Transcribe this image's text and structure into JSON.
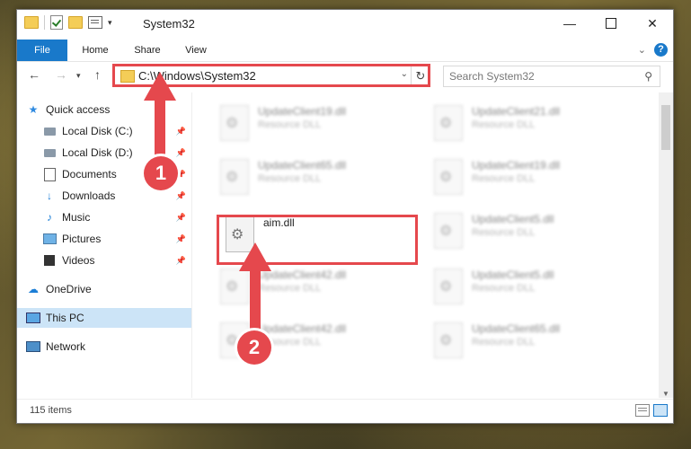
{
  "window": {
    "title": "System32"
  },
  "ribbon": {
    "tabs": [
      "File",
      "Home",
      "Share",
      "View"
    ],
    "help": "?"
  },
  "nav": {
    "back": "←",
    "forward": "→",
    "recent": "▾",
    "up": "↑"
  },
  "address": {
    "path": "C:\\Windows\\System32",
    "refresh": "↻",
    "dropdown": "⌄"
  },
  "search": {
    "placeholder": "Search System32",
    "icon": "⚲"
  },
  "sidebar": [
    {
      "label": "Quick access",
      "icon": "star-icon",
      "pinned": false
    },
    {
      "label": "Local Disk (C:)",
      "icon": "disk-icon",
      "pinned": true
    },
    {
      "label": "Local Disk (D:)",
      "icon": "disk-icon",
      "pinned": true
    },
    {
      "label": "Documents",
      "icon": "document-icon",
      "pinned": true
    },
    {
      "label": "Downloads",
      "icon": "download-icon",
      "pinned": true
    },
    {
      "label": "Music",
      "icon": "music-icon",
      "pinned": true
    },
    {
      "label": "Pictures",
      "icon": "pictures-icon",
      "pinned": true
    },
    {
      "label": "Videos",
      "icon": "videos-icon",
      "pinned": true
    },
    {
      "label": "OneDrive",
      "icon": "cloud-icon",
      "pinned": false
    },
    {
      "label": "This PC",
      "icon": "pc-icon",
      "pinned": false,
      "selected": true
    },
    {
      "label": "Network",
      "icon": "network-icon",
      "pinned": false
    }
  ],
  "files": [
    {
      "name": "UpdateClient19.dll",
      "type": "Resource DLL"
    },
    {
      "name": "UpdateClient21.dll",
      "type": "Resource DLL"
    },
    {
      "name": "UpdateClient65.dll",
      "type": "Resource DLL"
    },
    {
      "name": "UpdateClient19.dll",
      "type": "Resource DLL"
    },
    {
      "name": "aim.dll",
      "type": ""
    },
    {
      "name": "UpdateClient5.dll",
      "type": "Resource DLL"
    },
    {
      "name": "UpdateClient42.dll",
      "type": "Resource DLL"
    },
    {
      "name": "UpdateClient5.dll",
      "type": "Resource DLL"
    },
    {
      "name": "UpdateClient42.dll",
      "type": "Resource DLL"
    },
    {
      "name": "UpdateClient65.dll",
      "type": "Resource DLL"
    }
  ],
  "status": {
    "count": "115 items"
  },
  "markers": [
    "1",
    "2"
  ],
  "colors": {
    "accent": "#1979ca",
    "highlight": "#e5484d",
    "selected": "#cce4f7"
  }
}
